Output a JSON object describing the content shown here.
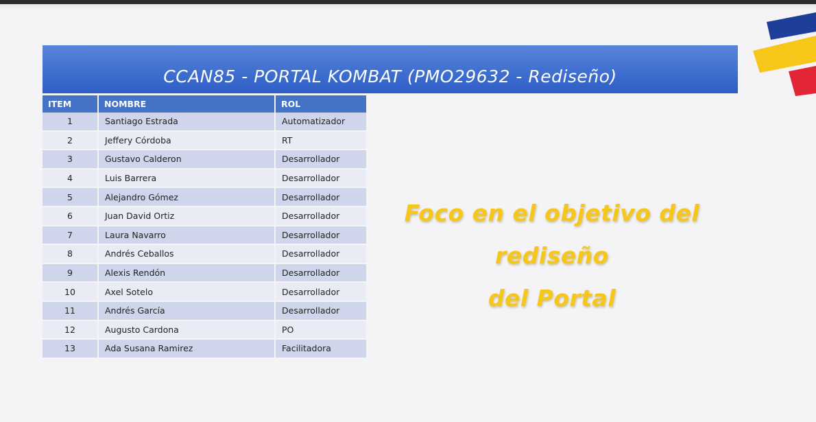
{
  "slide": {
    "title": "CCAN85 - PORTAL KOMBAT (PMO29632 - Rediseño)",
    "focus_line1": "Foco en el objetivo del rediseño",
    "focus_line2": "del Portal"
  },
  "colors": {
    "header_blue": "#4472c4",
    "row_odd": "#cfd5ea",
    "row_even": "#e9ebf5",
    "accent_yellow": "#f6c619",
    "logo_blue": "#1d3f99",
    "logo_yellow": "#f6c619",
    "logo_red": "#e32636"
  },
  "table": {
    "headers": {
      "item": "ITEM",
      "nombre": "NOMBRE",
      "rol": "ROL"
    },
    "rows": [
      {
        "item": "1",
        "nombre": "Santiago Estrada",
        "rol": "Automatizador"
      },
      {
        "item": "2",
        "nombre": "Jeffery Córdoba",
        "rol": "RT"
      },
      {
        "item": "3",
        "nombre": "Gustavo Calderon",
        "rol": "Desarrollador"
      },
      {
        "item": "4",
        "nombre": "Luis Barrera",
        "rol": "Desarrollador"
      },
      {
        "item": "5",
        "nombre": "Alejandro Gómez",
        "rol": "Desarrollador"
      },
      {
        "item": "6",
        "nombre": "Juan David Ortiz",
        "rol": "Desarrollador"
      },
      {
        "item": "7",
        "nombre": "Laura Navarro",
        "rol": "Desarrollador"
      },
      {
        "item": "8",
        "nombre": "Andrés Ceballos",
        "rol": "Desarrollador"
      },
      {
        "item": "9",
        "nombre": "Alexis Rendón",
        "rol": "Desarrollador"
      },
      {
        "item": "10",
        "nombre": "Axel Sotelo",
        "rol": "Desarrollador"
      },
      {
        "item": "11",
        "nombre": "Andrés García",
        "rol": "Desarrollador"
      },
      {
        "item": "12",
        "nombre": "Augusto Cardona",
        "rol": "PO"
      },
      {
        "item": "13",
        "nombre": "Ada Susana Ramirez",
        "rol": "Facilitadora"
      }
    ]
  }
}
